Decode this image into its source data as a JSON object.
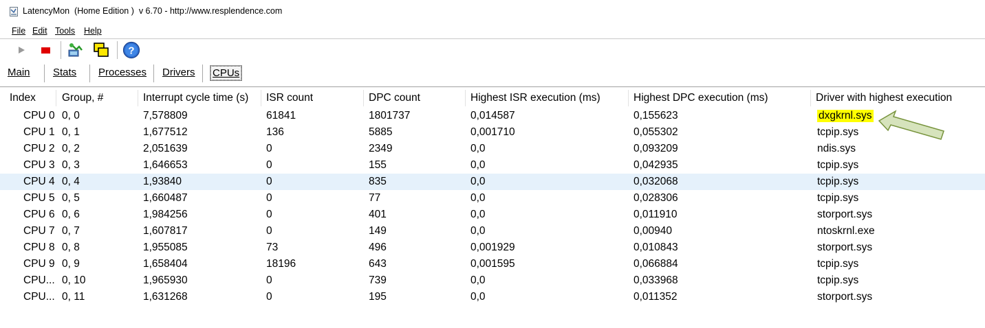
{
  "window": {
    "title": "LatencyMon  (Home Edition )  v 6.70 - http://www.resplendence.com",
    "app_icon": "latencymon-app-icon"
  },
  "menu": {
    "items": [
      "File",
      "Edit",
      "Tools",
      "Help"
    ]
  },
  "toolbar": {
    "buttons": [
      {
        "name": "play-icon",
        "state": "disabled"
      },
      {
        "name": "stop-icon",
        "color": "#e00000"
      },
      {
        "name": "analyze-icon"
      },
      {
        "name": "windows-icon"
      },
      {
        "name": "help-icon"
      }
    ]
  },
  "tabs": {
    "items": [
      "Main",
      "Stats",
      "Processes",
      "Drivers",
      "CPUs"
    ],
    "active": "CPUs"
  },
  "table": {
    "columns": [
      "Index",
      "Group, #",
      "Interrupt cycle time (s)",
      "ISR count",
      "DPC count",
      "Highest ISR execution (ms)",
      "Highest DPC execution (ms)",
      "Driver with highest execution"
    ],
    "rows": [
      [
        "CPU 0",
        "0, 0",
        "7,578809",
        "61841",
        "1801737",
        "0,014587",
        "0,155623",
        "dxgkrnl.sys"
      ],
      [
        "CPU 1",
        "0, 1",
        "1,677512",
        "136",
        "5885",
        "0,001710",
        "0,055302",
        "tcpip.sys"
      ],
      [
        "CPU 2",
        "0, 2",
        "2,051639",
        "0",
        "2349",
        "0,0",
        "0,093209",
        "ndis.sys"
      ],
      [
        "CPU 3",
        "0, 3",
        "1,646653",
        "0",
        "155",
        "0,0",
        "0,042935",
        "tcpip.sys"
      ],
      [
        "CPU 4",
        "0, 4",
        "1,93840",
        "0",
        "835",
        "0,0",
        "0,032068",
        "tcpip.sys"
      ],
      [
        "CPU 5",
        "0, 5",
        "1,660487",
        "0",
        "77",
        "0,0",
        "0,028306",
        "tcpip.sys"
      ],
      [
        "CPU 6",
        "0, 6",
        "1,984256",
        "0",
        "401",
        "0,0",
        "0,011910",
        "storport.sys"
      ],
      [
        "CPU 7",
        "0, 7",
        "1,607817",
        "0",
        "149",
        "0,0",
        "0,00940",
        "ntoskrnl.exe"
      ],
      [
        "CPU 8",
        "0, 8",
        "1,955085",
        "73",
        "496",
        "0,001929",
        "0,010843",
        "storport.sys"
      ],
      [
        "CPU 9",
        "0, 9",
        "1,658404",
        "18196",
        "643",
        "0,001595",
        "0,066884",
        "tcpip.sys"
      ],
      [
        "CPU...",
        "0, 10",
        "1,965930",
        "0",
        "739",
        "0,0",
        "0,033968",
        "tcpip.sys"
      ],
      [
        "CPU...",
        "0, 11",
        "1,631268",
        "0",
        "195",
        "0,0",
        "0,011352",
        "storport.sys"
      ]
    ],
    "selected_row_index": 4,
    "selected_row_color": "#e5f1fb",
    "highlighted_cell": {
      "row": 0,
      "column": 7,
      "color": "#ffff00"
    }
  },
  "annotation": {
    "name": "pointer-arrow-icon",
    "fill": "#d6e3bc",
    "stroke": "#77933c"
  }
}
